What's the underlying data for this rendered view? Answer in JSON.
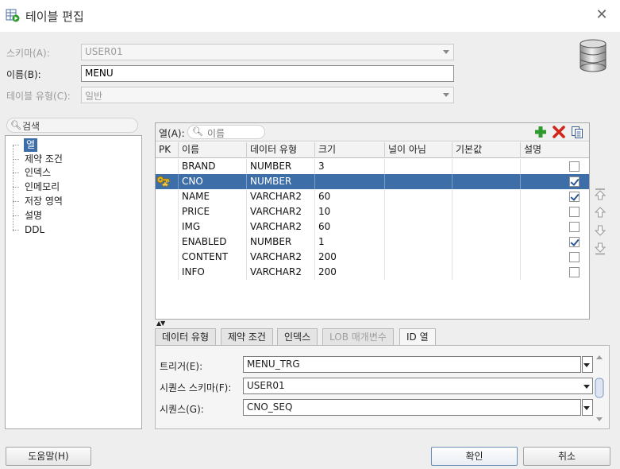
{
  "window": {
    "title": "테이블 편집"
  },
  "form": {
    "schema_label": "스키마(A):",
    "schema_value": "USER01",
    "name_label": "이름(B):",
    "name_value": "MENU",
    "type_label": "테이블 유형(C):",
    "type_value": "일반"
  },
  "sidebar": {
    "search_placeholder": "검색",
    "items": [
      {
        "label": "열"
      },
      {
        "label": "제약 조건"
      },
      {
        "label": "인덱스"
      },
      {
        "label": "인메모리"
      },
      {
        "label": "저장 영역"
      },
      {
        "label": "설명"
      },
      {
        "label": "DDL"
      }
    ]
  },
  "columns_panel": {
    "label": "열(A):",
    "search_placeholder": "이름",
    "headers": [
      "PK",
      "이름",
      "데이터 유형",
      "크기",
      "널이 아님",
      "기본값",
      "설명"
    ],
    "rows": [
      {
        "pk": false,
        "name": "BRAND",
        "type": "NUMBER",
        "size": "3",
        "not_null": false,
        "selected": false
      },
      {
        "pk": true,
        "name": "CNO",
        "type": "NUMBER",
        "size": "",
        "not_null": true,
        "selected": true
      },
      {
        "pk": false,
        "name": "NAME",
        "type": "VARCHAR2",
        "size": "60",
        "not_null": true,
        "selected": false
      },
      {
        "pk": false,
        "name": "PRICE",
        "type": "VARCHAR2",
        "size": "10",
        "not_null": false,
        "selected": false
      },
      {
        "pk": false,
        "name": "IMG",
        "type": "VARCHAR2",
        "size": "60",
        "not_null": false,
        "selected": false
      },
      {
        "pk": false,
        "name": "ENABLED",
        "type": "NUMBER",
        "size": "1",
        "not_null": true,
        "selected": false
      },
      {
        "pk": false,
        "name": "CONTENT",
        "type": "VARCHAR2",
        "size": "200",
        "not_null": false,
        "selected": false
      },
      {
        "pk": false,
        "name": "INFO",
        "type": "VARCHAR2",
        "size": "200",
        "not_null": false,
        "selected": false
      }
    ]
  },
  "detail_tabs": [
    {
      "label": "데이터 유형",
      "disabled": false,
      "active": false
    },
    {
      "label": "제약 조건",
      "disabled": false,
      "active": false
    },
    {
      "label": "인덱스",
      "disabled": false,
      "active": false
    },
    {
      "label": "LOB 매개변수",
      "disabled": true,
      "active": false
    },
    {
      "label": "ID 열",
      "disabled": false,
      "active": true
    }
  ],
  "id_column": {
    "trigger_label": "트리거(E):",
    "trigger_value": "MENU_TRG",
    "seq_schema_label": "시퀀스 스키마(F):",
    "seq_schema_value": "USER01",
    "sequence_label": "시퀀스(G):",
    "sequence_value": "CNO_SEQ"
  },
  "buttons": {
    "help": "도움말(H)",
    "ok": "확인",
    "cancel": "취소"
  },
  "colors": {
    "selection": "#3e6ea8",
    "add_icon": "#2e9a2e",
    "delete_icon": "#d0261b"
  }
}
